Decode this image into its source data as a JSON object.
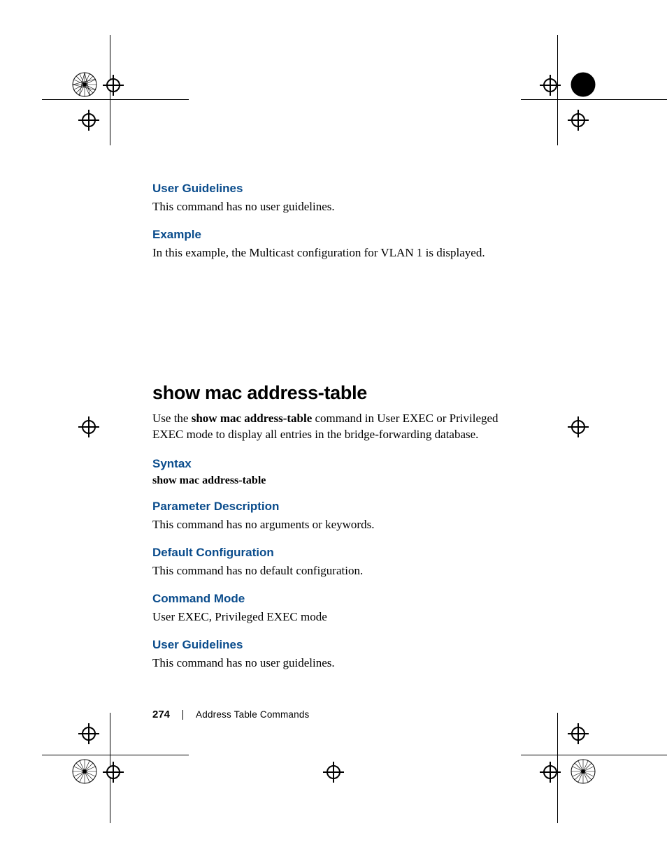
{
  "sections": {
    "user_guidelines_1": {
      "heading": "User Guidelines",
      "body": "This command has no user guidelines."
    },
    "example": {
      "heading": "Example",
      "body": "In this example, the Multicast configuration for VLAN 1 is displayed."
    }
  },
  "main": {
    "title": "show mac address-table",
    "intro_pre": "Use the ",
    "intro_bold": "show mac address-table",
    "intro_post": " command in User EXEC or Privileged EXEC mode to display all entries in the bridge-forwarding database.",
    "syntax": {
      "heading": "Syntax",
      "line": "show mac address-table"
    },
    "param": {
      "heading": "Parameter Description",
      "body": "This command has no arguments or keywords."
    },
    "default": {
      "heading": "Default Configuration",
      "body": "This command has no default configuration."
    },
    "mode": {
      "heading": "Command Mode",
      "body": "User EXEC, Privileged EXEC mode"
    },
    "ug2": {
      "heading": "User Guidelines",
      "body": "This command has no user guidelines."
    }
  },
  "footer": {
    "page_number": "274",
    "chapter": "Address Table Commands"
  }
}
